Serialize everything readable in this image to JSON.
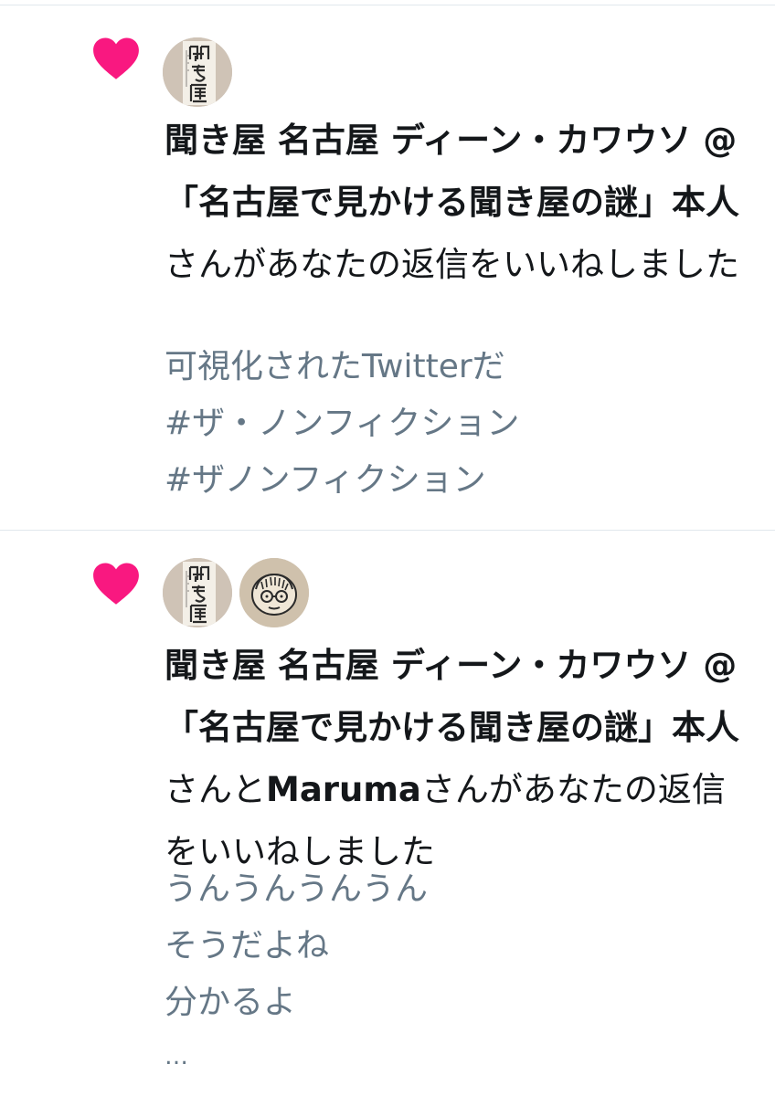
{
  "colors": {
    "heart": "#f91880",
    "primary_text": "#14171a",
    "secondary_text": "#657786",
    "divider": "#e1e8ed"
  },
  "notifications": [
    {
      "icon": "heart-icon",
      "actors": [
        "聞き屋 名古屋 ディーン・カワウソ @「名古屋で見かける聞き屋の謎」本人"
      ],
      "connector": "",
      "action_text": "さんがあなたの返信をいいねしました",
      "preview_lines": [
        "可視化されたTwitterだ",
        "#ザ・ノンフィクション",
        "#ザノンフィクション"
      ]
    },
    {
      "icon": "heart-icon",
      "actors": [
        "聞き屋 名古屋 ディーン・カワウソ @「名古屋で見かける聞き屋の謎」本人",
        "Maruma"
      ],
      "connector": "さんと",
      "action_text": "さんがあなたの返信をいいねしました",
      "preview_lines": [
        "うんうんうんうん",
        "そうだよね",
        "分かるよ",
        "…"
      ]
    }
  ]
}
